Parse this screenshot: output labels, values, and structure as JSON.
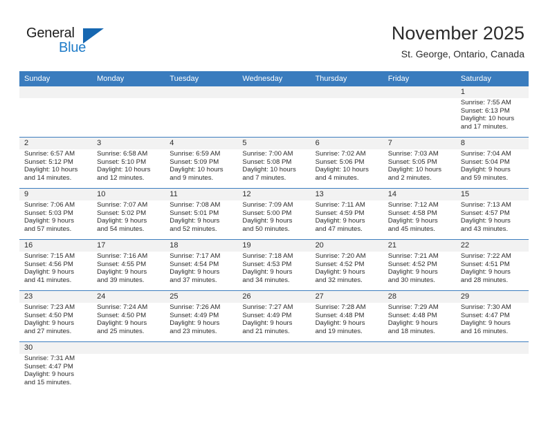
{
  "brand": {
    "name_part1": "General",
    "name_part2": "Blue",
    "accent_color": "#1e7bc8",
    "triangle_color": "#1667b1"
  },
  "header": {
    "title": "November 2025",
    "subtitle": "St. George, Ontario, Canada"
  },
  "theme": {
    "header_blue": "#3a7cbe",
    "daynum_band": "#f2f2f2",
    "text": "#2b2b2b"
  },
  "weekday_headers": [
    "Sunday",
    "Monday",
    "Tuesday",
    "Wednesday",
    "Thursday",
    "Friday",
    "Saturday"
  ],
  "weeks": [
    [
      {
        "day": "",
        "info": ""
      },
      {
        "day": "",
        "info": ""
      },
      {
        "day": "",
        "info": ""
      },
      {
        "day": "",
        "info": ""
      },
      {
        "day": "",
        "info": ""
      },
      {
        "day": "",
        "info": ""
      },
      {
        "day": "1",
        "info": "Sunrise: 7:55 AM\nSunset: 6:13 PM\nDaylight: 10 hours\nand 17 minutes."
      }
    ],
    [
      {
        "day": "2",
        "info": "Sunrise: 6:57 AM\nSunset: 5:12 PM\nDaylight: 10 hours\nand 14 minutes."
      },
      {
        "day": "3",
        "info": "Sunrise: 6:58 AM\nSunset: 5:10 PM\nDaylight: 10 hours\nand 12 minutes."
      },
      {
        "day": "4",
        "info": "Sunrise: 6:59 AM\nSunset: 5:09 PM\nDaylight: 10 hours\nand 9 minutes."
      },
      {
        "day": "5",
        "info": "Sunrise: 7:00 AM\nSunset: 5:08 PM\nDaylight: 10 hours\nand 7 minutes."
      },
      {
        "day": "6",
        "info": "Sunrise: 7:02 AM\nSunset: 5:06 PM\nDaylight: 10 hours\nand 4 minutes."
      },
      {
        "day": "7",
        "info": "Sunrise: 7:03 AM\nSunset: 5:05 PM\nDaylight: 10 hours\nand 2 minutes."
      },
      {
        "day": "8",
        "info": "Sunrise: 7:04 AM\nSunset: 5:04 PM\nDaylight: 9 hours\nand 59 minutes."
      }
    ],
    [
      {
        "day": "9",
        "info": "Sunrise: 7:06 AM\nSunset: 5:03 PM\nDaylight: 9 hours\nand 57 minutes."
      },
      {
        "day": "10",
        "info": "Sunrise: 7:07 AM\nSunset: 5:02 PM\nDaylight: 9 hours\nand 54 minutes."
      },
      {
        "day": "11",
        "info": "Sunrise: 7:08 AM\nSunset: 5:01 PM\nDaylight: 9 hours\nand 52 minutes."
      },
      {
        "day": "12",
        "info": "Sunrise: 7:09 AM\nSunset: 5:00 PM\nDaylight: 9 hours\nand 50 minutes."
      },
      {
        "day": "13",
        "info": "Sunrise: 7:11 AM\nSunset: 4:59 PM\nDaylight: 9 hours\nand 47 minutes."
      },
      {
        "day": "14",
        "info": "Sunrise: 7:12 AM\nSunset: 4:58 PM\nDaylight: 9 hours\nand 45 minutes."
      },
      {
        "day": "15",
        "info": "Sunrise: 7:13 AM\nSunset: 4:57 PM\nDaylight: 9 hours\nand 43 minutes."
      }
    ],
    [
      {
        "day": "16",
        "info": "Sunrise: 7:15 AM\nSunset: 4:56 PM\nDaylight: 9 hours\nand 41 minutes."
      },
      {
        "day": "17",
        "info": "Sunrise: 7:16 AM\nSunset: 4:55 PM\nDaylight: 9 hours\nand 39 minutes."
      },
      {
        "day": "18",
        "info": "Sunrise: 7:17 AM\nSunset: 4:54 PM\nDaylight: 9 hours\nand 37 minutes."
      },
      {
        "day": "19",
        "info": "Sunrise: 7:18 AM\nSunset: 4:53 PM\nDaylight: 9 hours\nand 34 minutes."
      },
      {
        "day": "20",
        "info": "Sunrise: 7:20 AM\nSunset: 4:52 PM\nDaylight: 9 hours\nand 32 minutes."
      },
      {
        "day": "21",
        "info": "Sunrise: 7:21 AM\nSunset: 4:52 PM\nDaylight: 9 hours\nand 30 minutes."
      },
      {
        "day": "22",
        "info": "Sunrise: 7:22 AM\nSunset: 4:51 PM\nDaylight: 9 hours\nand 28 minutes."
      }
    ],
    [
      {
        "day": "23",
        "info": "Sunrise: 7:23 AM\nSunset: 4:50 PM\nDaylight: 9 hours\nand 27 minutes."
      },
      {
        "day": "24",
        "info": "Sunrise: 7:24 AM\nSunset: 4:50 PM\nDaylight: 9 hours\nand 25 minutes."
      },
      {
        "day": "25",
        "info": "Sunrise: 7:26 AM\nSunset: 4:49 PM\nDaylight: 9 hours\nand 23 minutes."
      },
      {
        "day": "26",
        "info": "Sunrise: 7:27 AM\nSunset: 4:49 PM\nDaylight: 9 hours\nand 21 minutes."
      },
      {
        "day": "27",
        "info": "Sunrise: 7:28 AM\nSunset: 4:48 PM\nDaylight: 9 hours\nand 19 minutes."
      },
      {
        "day": "28",
        "info": "Sunrise: 7:29 AM\nSunset: 4:48 PM\nDaylight: 9 hours\nand 18 minutes."
      },
      {
        "day": "29",
        "info": "Sunrise: 7:30 AM\nSunset: 4:47 PM\nDaylight: 9 hours\nand 16 minutes."
      }
    ],
    [
      {
        "day": "30",
        "info": "Sunrise: 7:31 AM\nSunset: 4:47 PM\nDaylight: 9 hours\nand 15 minutes."
      },
      {
        "day": "",
        "info": ""
      },
      {
        "day": "",
        "info": ""
      },
      {
        "day": "",
        "info": ""
      },
      {
        "day": "",
        "info": ""
      },
      {
        "day": "",
        "info": ""
      },
      {
        "day": "",
        "info": ""
      }
    ]
  ]
}
